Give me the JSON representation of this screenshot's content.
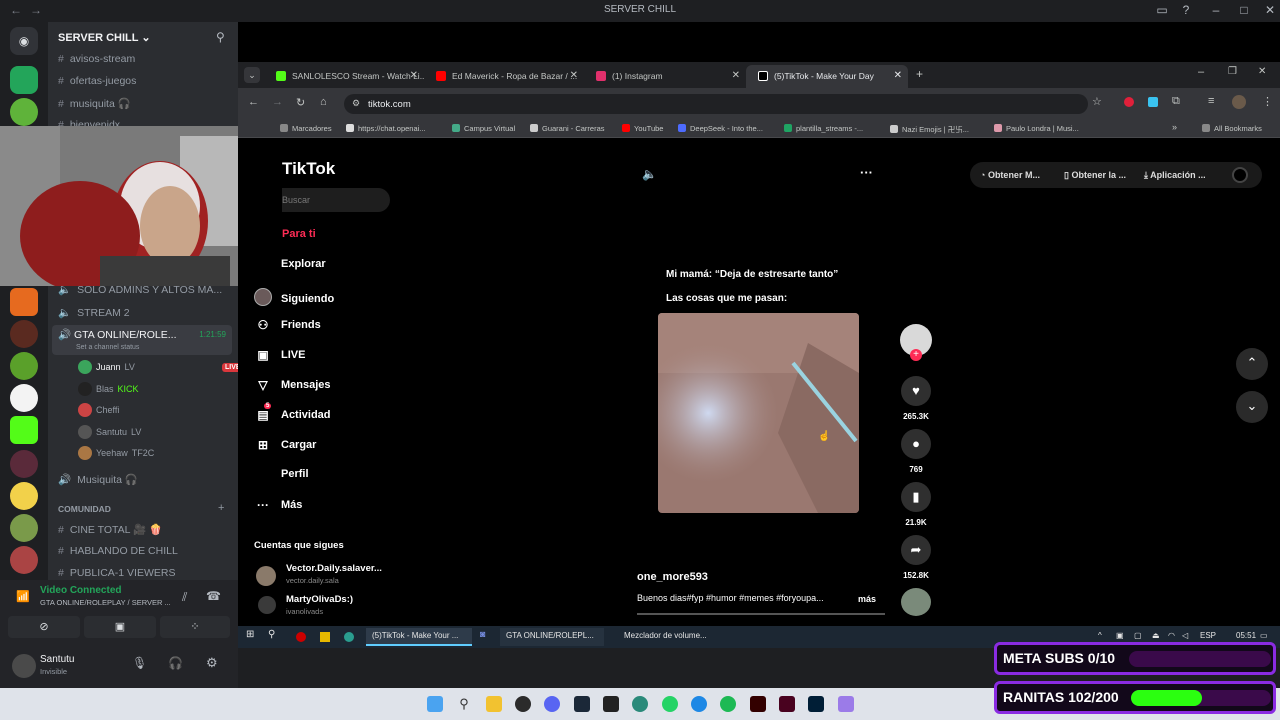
{
  "discord": {
    "window_title": "SERVER CHILL",
    "server_name": "SERVER CHILL",
    "channels_top": [
      {
        "prefix": "#",
        "name": "avisos-stream"
      },
      {
        "prefix": "#",
        "name": "ofertas-juegos"
      },
      {
        "prefix": "#",
        "name": "musiquita 🎧"
      },
      {
        "prefix": "#",
        "name": "bienvenidx"
      }
    ],
    "voice_channels": [
      {
        "name": "SOLO ADMINS Y ALTOS MA..."
      },
      {
        "name": "STREAM 2"
      },
      {
        "name": "GTA ONLINE/ROLE...",
        "timer": "1:21:59",
        "status": "Set a channel status"
      }
    ],
    "voice_users": [
      {
        "name": "Juann",
        "tag": "LV",
        "live": "LIVE",
        "color": "#3ba55c"
      },
      {
        "name": "Blas",
        "tag": "KICK",
        "color": "#222222"
      },
      {
        "name": "Cheffi",
        "tag": "",
        "color": "#c44"
      },
      {
        "name": "Santutu",
        "tag": "LV",
        "color": "#555"
      },
      {
        "name": "Yeehaw",
        "tag": "TF2C",
        "color": "#aa7744"
      }
    ],
    "after_voice": [
      {
        "prefix": "🔊",
        "name": "Musiquita 🎧"
      }
    ],
    "category": "COMUNIDAD",
    "channels_bottom": [
      {
        "prefix": "#",
        "name": "CINE TOTAL 🎥 🍿"
      },
      {
        "prefix": "#",
        "name": "HABLANDO DE CHILL"
      },
      {
        "prefix": "#",
        "name": "PUBLICA-1 VIEWERS"
      }
    ],
    "voice_connected": "Video Connected",
    "voice_channel_path": "GTA ONLINE/ROLEPLAY / SERVER ...",
    "user_name": "Santutu",
    "user_status": "Invisible"
  },
  "browser": {
    "tabs": [
      {
        "label": "SANLOLESCO Stream - Watch Li...",
        "color": "#53fc18"
      },
      {
        "label": "Ed Maverick - Ropa de Bazar / ...",
        "color": "#ff0000"
      },
      {
        "label": "(1) Instagram",
        "color": "#e1306c"
      },
      {
        "label": "(5)TikTok - Make Your Day",
        "color": "#ffffff"
      }
    ],
    "url": "tiktok.com",
    "bookmarks": [
      "Marcadores",
      "https://chat.openai...",
      "Campus Virtual",
      "Guarani - Carreras",
      "YouTube",
      "DeepSeek - Into the...",
      "plantilla_streams -...",
      "Nazi Emojis | 卍卐...",
      "Paulo Londra | Musi..."
    ],
    "all_bookmarks": "All Bookmarks"
  },
  "tiktok": {
    "logo": "TikTok",
    "search_placeholder": "Buscar",
    "nav": [
      {
        "label": "Para ti",
        "icon": "home-icon",
        "active": true
      },
      {
        "label": "Explorar",
        "icon": "compass-icon"
      },
      {
        "label": "Siguiendo",
        "icon": "following-icon"
      },
      {
        "label": "Friends",
        "icon": "friends-icon"
      },
      {
        "label": "LIVE",
        "icon": "live-icon"
      },
      {
        "label": "Mensajes",
        "icon": "messages-icon"
      },
      {
        "label": "Actividad",
        "icon": "activity-icon",
        "badge": "5"
      },
      {
        "label": "Cargar",
        "icon": "upload-icon"
      },
      {
        "label": "Perfil",
        "icon": "profile-icon"
      },
      {
        "label": "Más",
        "icon": "more-icon"
      }
    ],
    "following_header": "Cuentas que sigues",
    "following": [
      {
        "name": "Vector.Daily.salaver...",
        "handle": "vector.daily.sala"
      },
      {
        "name": "MartyOlivaDs:)",
        "handle": "ivanolivads"
      }
    ],
    "top_actions": [
      "Obtener M...",
      "Obtener la ...",
      "Aplicación ..."
    ],
    "video_caption_1": "Mi mamá: “Deja de estresarte tanto”",
    "video_caption_2": "Las cosas que me pasan:",
    "author": "one_more593",
    "description": "Buenos dias#fyp #humor #memes #foryoupa...",
    "more": "más",
    "stats": {
      "likes": "265.3K",
      "comments": "769",
      "saves": "21.9K",
      "shares": "152.8K"
    }
  },
  "win_taskbar": {
    "items": [
      "(5)TikTok - Make Your ...",
      "GTA ONLINE/ROLEPL...",
      "Mezclador de volume..."
    ],
    "lang": "ESP",
    "time": "05:51"
  },
  "overlays": {
    "meta_subs": {
      "label": "META SUBS 0/10",
      "progress": 0.0
    },
    "ranitas": {
      "label": "RANITAS 102/200",
      "progress": 0.51
    }
  }
}
